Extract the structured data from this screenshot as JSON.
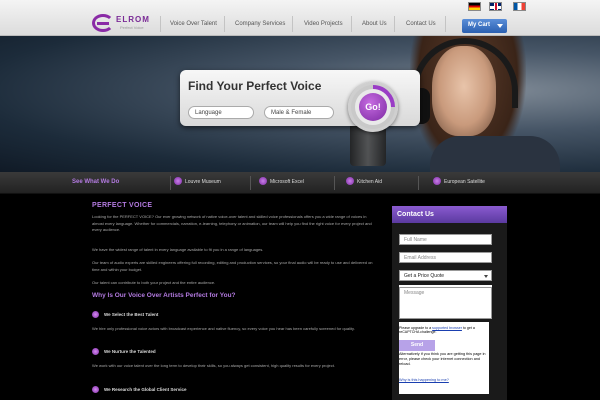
{
  "brand": {
    "name": "ELROM",
    "tagline": "Perfect Voice"
  },
  "nav": [
    {
      "label": "Voice Over Talent"
    },
    {
      "label": "Company Services"
    },
    {
      "label": "Video Projects"
    },
    {
      "label": "About Us"
    },
    {
      "label": "Contact Us"
    }
  ],
  "cart": {
    "label": "My Cart"
  },
  "languages": [
    {
      "icon": "flag-germany-icon"
    },
    {
      "icon": "flag-uk-icon"
    },
    {
      "icon": "flag-france-icon"
    }
  ],
  "hero": {
    "title": "Find Your Perfect Voice",
    "language_field": "Language",
    "gender_field": "Male & Female",
    "go_label": "Go!"
  },
  "strip": {
    "title": "See What We Do",
    "items": [
      {
        "label": "Louvre Museum"
      },
      {
        "label": "Microsoft Excel"
      },
      {
        "label": "Kitchen Aid"
      },
      {
        "label": "European Satellite"
      }
    ]
  },
  "content": {
    "title": "PERFECT VOICE",
    "paragraphs": [
      "Looking for the PERFECT VOICE? Our ever growing network of native voice-over talent and skilled voice professionals offers you a wide range of voices in almost every language. Whether for commercials, narration, e-learning, telephony or animation, our team will help you find the right voice for every project and every audience.",
      "We have the widest range of talent in every language available to fit you in a range of languages.",
      "Our team of audio experts are skilled engineers offering full recording, editing and production services, so your final audio will be ready to use and delivered on time and within your budget.",
      "Our talent can contribute to both your project and the entire audience."
    ],
    "subtitle": "Why Is Our Voice Over Artists Perfect for You?",
    "features": [
      {
        "label": "We Select the Best Talent"
      },
      {
        "label": "We Nurture the Talented"
      },
      {
        "label": "We Research the Global Client Service"
      }
    ],
    "feature_texts": [
      "We hire only professional voice actors with broadcast experience and native fluency, so every voice you hear has been carefully screened for quality.",
      "We work with our voice talent over the long term to develop their skills, so you always get consistent, high quality results for every project."
    ]
  },
  "contact": {
    "title": "Contact Us",
    "name_placeholder": "Full Name",
    "email_placeholder": "Email Address",
    "quote_select": "Get a Price Quote",
    "phone_placeholder": "Telephone Number",
    "message_placeholder": "Message",
    "captcha": {
      "notice_prefix": "Please upgrade to a",
      "notice_link": "supported browser",
      "notice_suffix": "to get a reCAPTCHA challenge.",
      "send_label": "Send",
      "alt_text": "Alternatively if you think you are getting this page in error, please check your internet connection and reload.",
      "why_link": "Why is this happening to me?"
    }
  }
}
